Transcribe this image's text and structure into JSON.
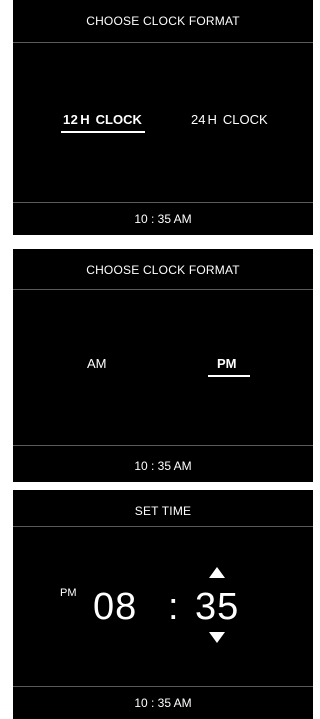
{
  "screens": [
    {
      "header": "CHOOSE CLOCK FORMAT",
      "options": [
        {
          "num": "12",
          "unit": "H",
          "word": "CLOCK",
          "selected": true
        },
        {
          "num": "24",
          "unit": "H",
          "word": "CLOCK",
          "selected": false
        }
      ],
      "footer_time": "10 : 35 AM"
    },
    {
      "header": "CHOOSE CLOCK FORMAT",
      "options": [
        {
          "label": "AM",
          "selected": false
        },
        {
          "label": "PM",
          "selected": true
        }
      ],
      "footer_time": "10 : 35 AM"
    },
    {
      "header": "SET TIME",
      "period": "PM",
      "hours": "08",
      "separator": ":",
      "minutes": "35",
      "footer_time": "10 : 35 AM"
    }
  ],
  "colors": {
    "background": "#000000",
    "text": "#ffffff",
    "divider": "#5a5a5a"
  },
  "icons": [
    "arrow-up-icon",
    "arrow-down-icon"
  ]
}
